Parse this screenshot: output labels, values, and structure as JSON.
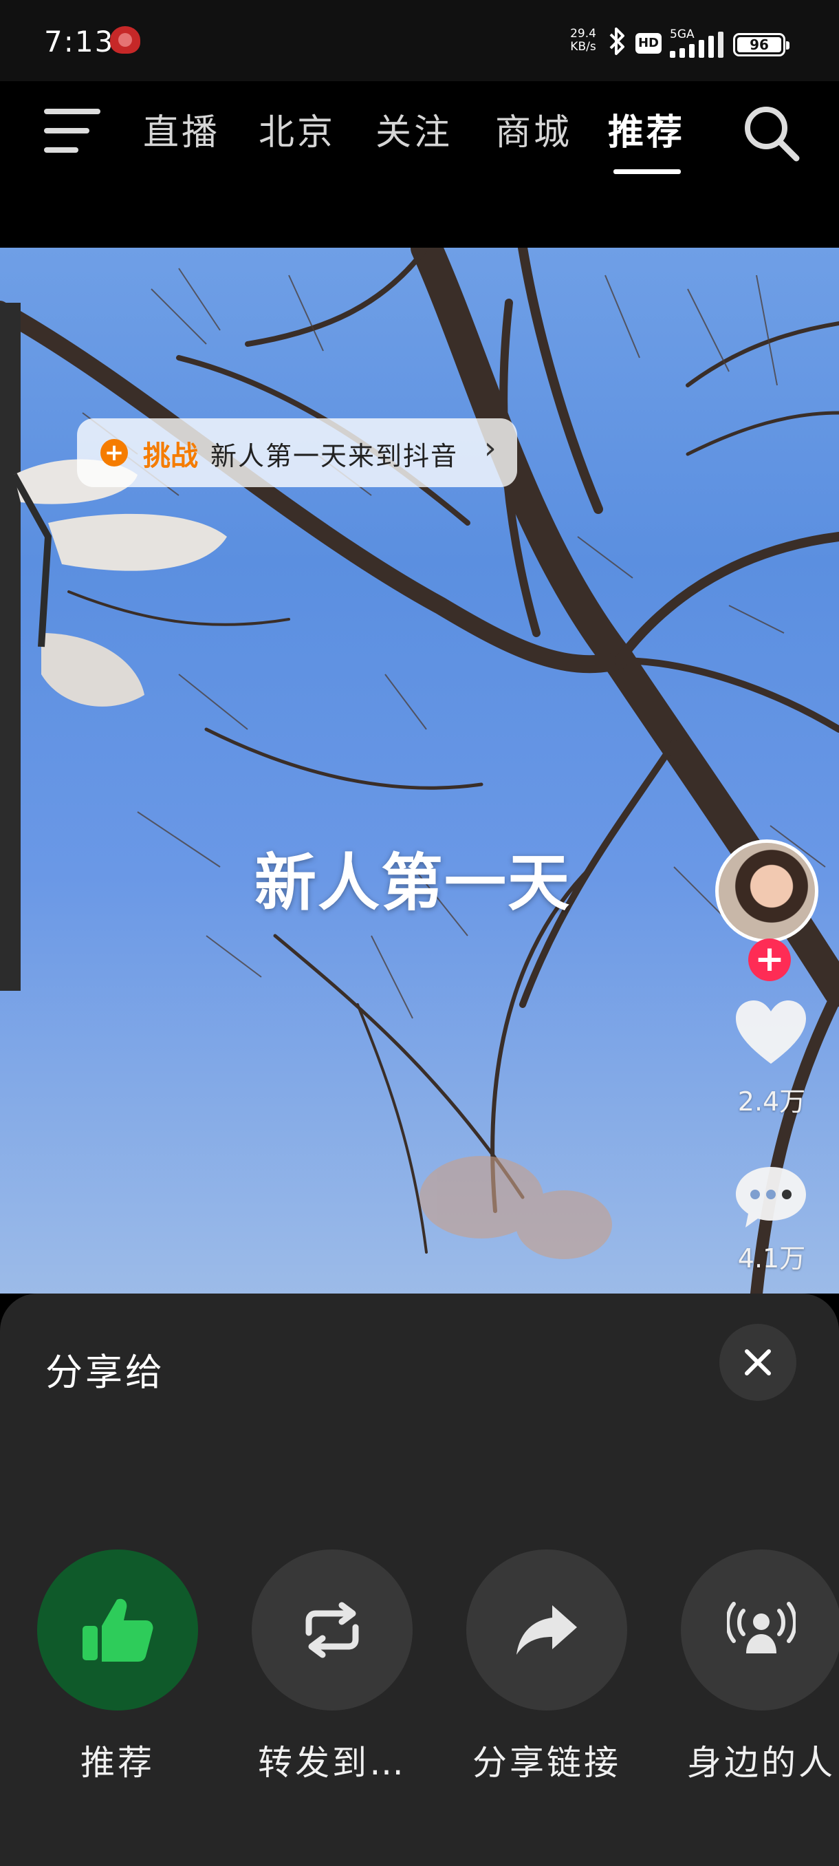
{
  "status_bar": {
    "time": "7:13",
    "net_speed_value": "29.4",
    "net_speed_unit": "KB/s",
    "hd_label": "HD",
    "signal_label": "5GA",
    "battery": "96"
  },
  "top_nav": {
    "tabs": [
      {
        "label": "直播"
      },
      {
        "label": "北京"
      },
      {
        "label": "关注"
      },
      {
        "label": "商城"
      },
      {
        "label": "推荐"
      }
    ],
    "active_tab": "推荐"
  },
  "video": {
    "challenge_tag": "挑战",
    "challenge_name": "新人第一天来到抖音",
    "caption": "新人第一天",
    "like_count": "2.4万",
    "comment_count": "4.1万"
  },
  "share_sheet": {
    "title": "分享给",
    "items": [
      {
        "label": "推荐",
        "icon": "thumbs-up-icon"
      },
      {
        "label": "转发到…",
        "icon": "repost-icon"
      },
      {
        "label": "分享链接",
        "icon": "share-arrow-icon"
      },
      {
        "label": "身边的人",
        "icon": "nearby-broadcast-icon"
      }
    ]
  },
  "colors": {
    "accent_red": "#fe2c55",
    "challenge_orange": "#f57c00",
    "recommend_green": "#0f5a2a",
    "sheet_bg": "#262626"
  }
}
